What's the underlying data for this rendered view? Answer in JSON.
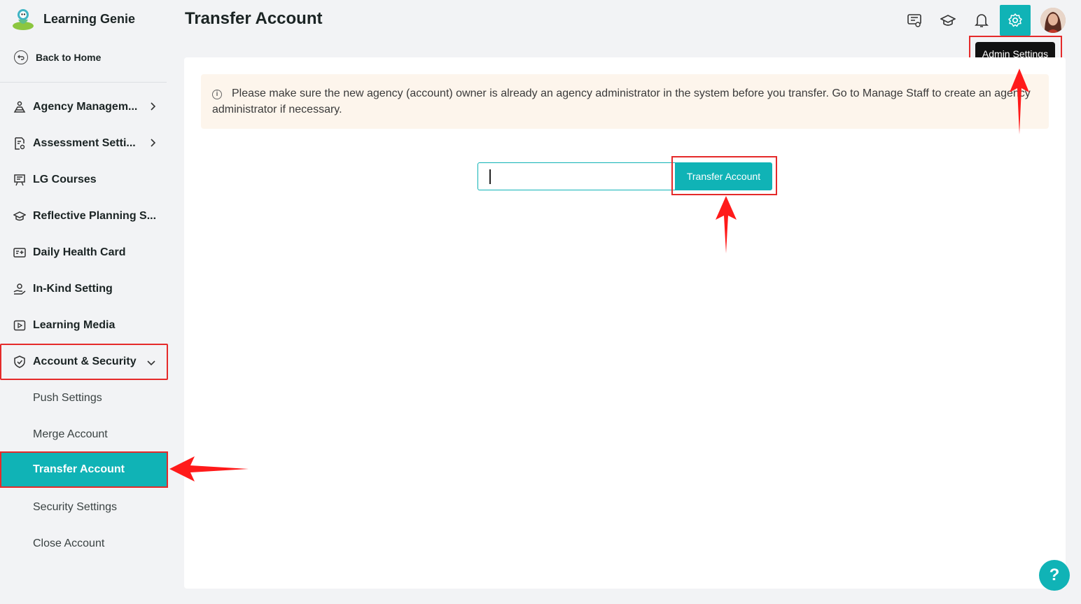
{
  "app": {
    "name": "Learning Genie"
  },
  "sidebar": {
    "back_home": "Back to Home",
    "items": [
      {
        "label": "Agency Managem...",
        "icon": "agency-icon",
        "chevron": "right"
      },
      {
        "label": "Assessment Setti...",
        "icon": "assessment-icon",
        "chevron": "right"
      },
      {
        "label": "LG Courses",
        "icon": "courses-icon"
      },
      {
        "label": "Reflective Planning S...",
        "icon": "graduation-cap-icon"
      },
      {
        "label": "Daily Health Card",
        "icon": "health-card-icon"
      },
      {
        "label": "In-Kind Setting",
        "icon": "hand-icon"
      },
      {
        "label": "Learning Media",
        "icon": "play-icon"
      },
      {
        "label": "Account & Security",
        "icon": "shield-icon",
        "chevron": "down",
        "expanded": true
      }
    ],
    "sub_items": [
      {
        "label": "Push Settings"
      },
      {
        "label": "Merge Account"
      },
      {
        "label": "Transfer Account",
        "selected": true
      },
      {
        "label": "Security Settings"
      },
      {
        "label": "Close Account"
      }
    ]
  },
  "header": {
    "title": "Transfer Account",
    "tooltip": "Admin Settings",
    "icons": [
      "chat-icon",
      "graduation-cap-icon",
      "bell-icon",
      "gear-icon",
      "avatar"
    ]
  },
  "main": {
    "notice": "Please make sure the new agency (account) owner is already an agency administrator in the system before you transfer. Go to Manage Staff to create an agency administrator if necessary.",
    "input_value": "",
    "button_label": "Transfer Account"
  },
  "help": {
    "label": "?"
  },
  "colors": {
    "accent": "#10b3b6",
    "highlight": "#e52a2a",
    "notice_bg": "#fdf5ec"
  }
}
